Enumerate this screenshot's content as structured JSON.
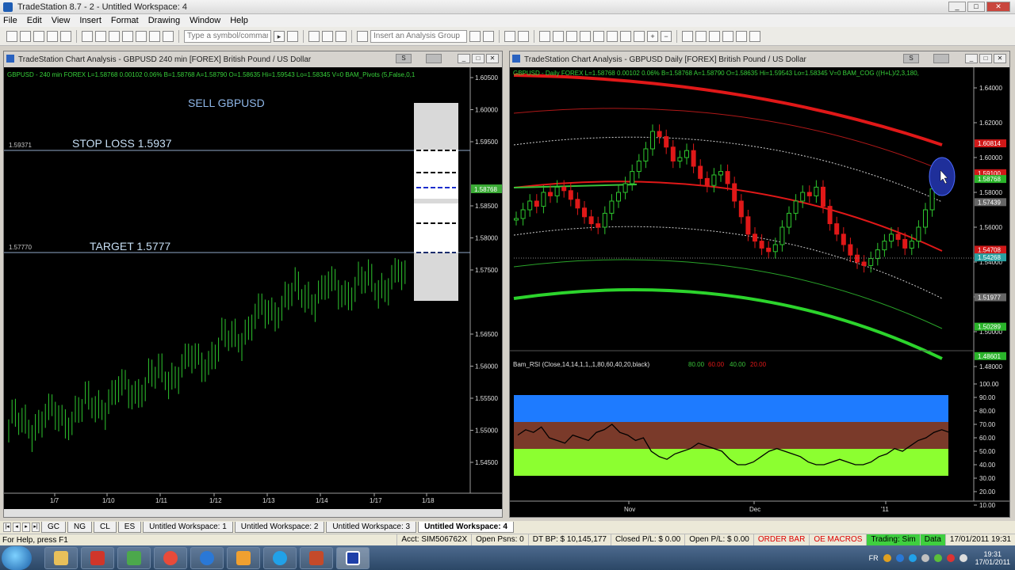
{
  "app": {
    "title": "TradeStation 8.7 - 2 - Untitled Workspace: 4"
  },
  "menu": [
    "File",
    "Edit",
    "View",
    "Insert",
    "Format",
    "Drawing",
    "Window",
    "Help"
  ],
  "toolbar": {
    "symbol_placeholder": "Type a symbol/command",
    "analysis_group": "Insert an Analysis Group"
  },
  "left_chart": {
    "title": "TradeStation Chart Analysis - GBPUSD 240 min [FOREX] British Pound / US Dollar",
    "info": "GBPUSD - 240 min  FOREX  L=1.58768  0.00102  0.06%  B=1.58768  A=1.58790  O=1.58635  Hi=1.59543  Lo=1.58345  V=0  BAM_Pivots (5,False,0,1",
    "sell_label": "SELL GBPUSD",
    "stop_label": "STOP LOSS 1.5937",
    "target_label": "TARGET  1.5777",
    "stop_line_value": "1.59371",
    "target_line_value": "1.57770",
    "last_price": "1.58768",
    "price_axis": [
      "1.60500",
      "1.60000",
      "1.59500",
      "1.58500",
      "1.58000",
      "1.57500",
      "1.56500",
      "1.56000",
      "1.55500",
      "1.55000",
      "1.54500"
    ],
    "date_axis": [
      "1/7",
      "1/10",
      "1/11",
      "1/12",
      "1/13",
      "1/14",
      "1/17",
      "1/18"
    ]
  },
  "right_chart": {
    "title": "TradeStation Chart Analysis - GBPUSD Daily [FOREX] British Pound / US Dollar",
    "info": "GBPUSD - Daily  FOREX  L=1.58768  0.00102  0.06%  B=1.58768  A=1.58790  O=1.58635  Hi=1.59543  Lo=1.58345  V=0  BAM_COG ((H+L)/2,3,180,",
    "price_axis": [
      "1.64000",
      "1.62000",
      "1.60000",
      "1.58000",
      "1.56000",
      "1.54000",
      "1.52000",
      "1.50000",
      "1.48000"
    ],
    "tags": [
      "1.60814",
      "1.59100",
      "1.58768",
      "1.57439",
      "1.54708",
      "1.54268",
      "1.51977",
      "1.50289",
      "1.48601"
    ],
    "rsi_info": "Bam_RSI (Close,14,14,1,1,,1,80,60,40,20,black)",
    "rsi_levels": [
      "80.00",
      "60.00",
      "40.00",
      "20.00"
    ],
    "rsi_axis": [
      "100.00",
      "90.00",
      "80.00",
      "70.00",
      "60.00",
      "50.00",
      "40.00",
      "30.00",
      "20.00",
      "10.00"
    ],
    "date_axis": [
      "Nov",
      "Dec",
      "'11"
    ]
  },
  "sheet_tabs": [
    "GC",
    "NG",
    "CL",
    "ES",
    "Untitled Workspace: 1",
    "Untitled Workspace: 2",
    "Untitled Workspace: 3",
    "Untitled Workspace: 4"
  ],
  "status": {
    "help": "For Help, press F1",
    "acct": "Acct: SIM506762X",
    "open_psns": "Open Psns: 0",
    "dt_bp": "DT BP: $ 10,145,177",
    "closed_pl": "Closed P/L: $ 0.00",
    "open_pl": "Open P/L: $ 0.00",
    "order_bar": "ORDER BAR",
    "oe_macros": "OE MACROS",
    "trading": "Trading: Sim",
    "data": "Data",
    "datetime": "17/01/2011 19:31"
  },
  "tray": {
    "lang": "FR",
    "time": "19:31",
    "date": "17/01/2011"
  }
}
